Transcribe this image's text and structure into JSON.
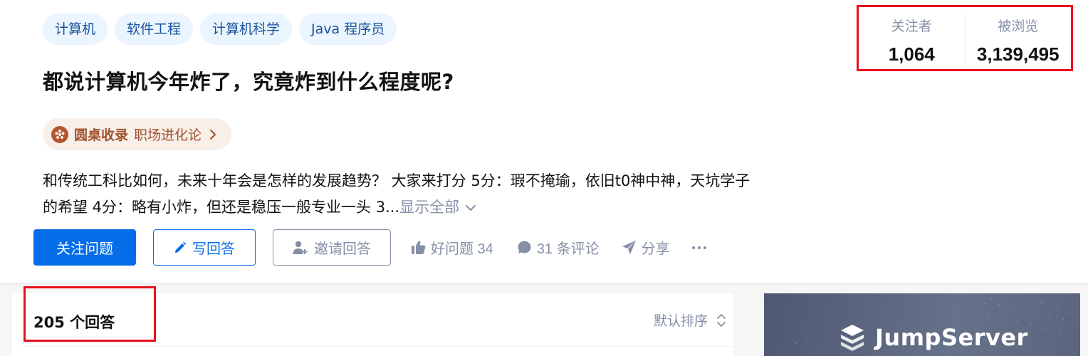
{
  "topics": [
    "计算机",
    "软件工程",
    "计算机科学",
    "Java 程序员"
  ],
  "question": {
    "title": "都说计算机今年炸了，究竟炸到什么程度呢?",
    "roundtable_label": "圆桌收录",
    "roundtable_name": "职场进化论",
    "description": "和传统工科比如何，未来十年会是怎样的发展趋势？ 大家来打分 5分：瑕不掩瑜，依旧t0神中神，天坑学子的希望 4分：略有小炸，但还是稳压一般专业一头 3...",
    "show_all": "显示全部"
  },
  "stats": {
    "followers_label": "关注者",
    "followers_value": "1,064",
    "views_label": "被浏览",
    "views_value": "3,139,495"
  },
  "actions": {
    "follow": "关注问题",
    "write": "写回答",
    "invite": "邀请回答",
    "good_question": "好问题 34",
    "comments": "31 条评论",
    "share": "分享"
  },
  "answers": {
    "count": "205 个回答",
    "sort": "默认排序"
  },
  "ad": {
    "brand": "JumpServer"
  },
  "colors": {
    "primary": "#056de8",
    "highlight": "#e8101d",
    "muted": "#8590a6",
    "roundtable": "#a0522d"
  }
}
